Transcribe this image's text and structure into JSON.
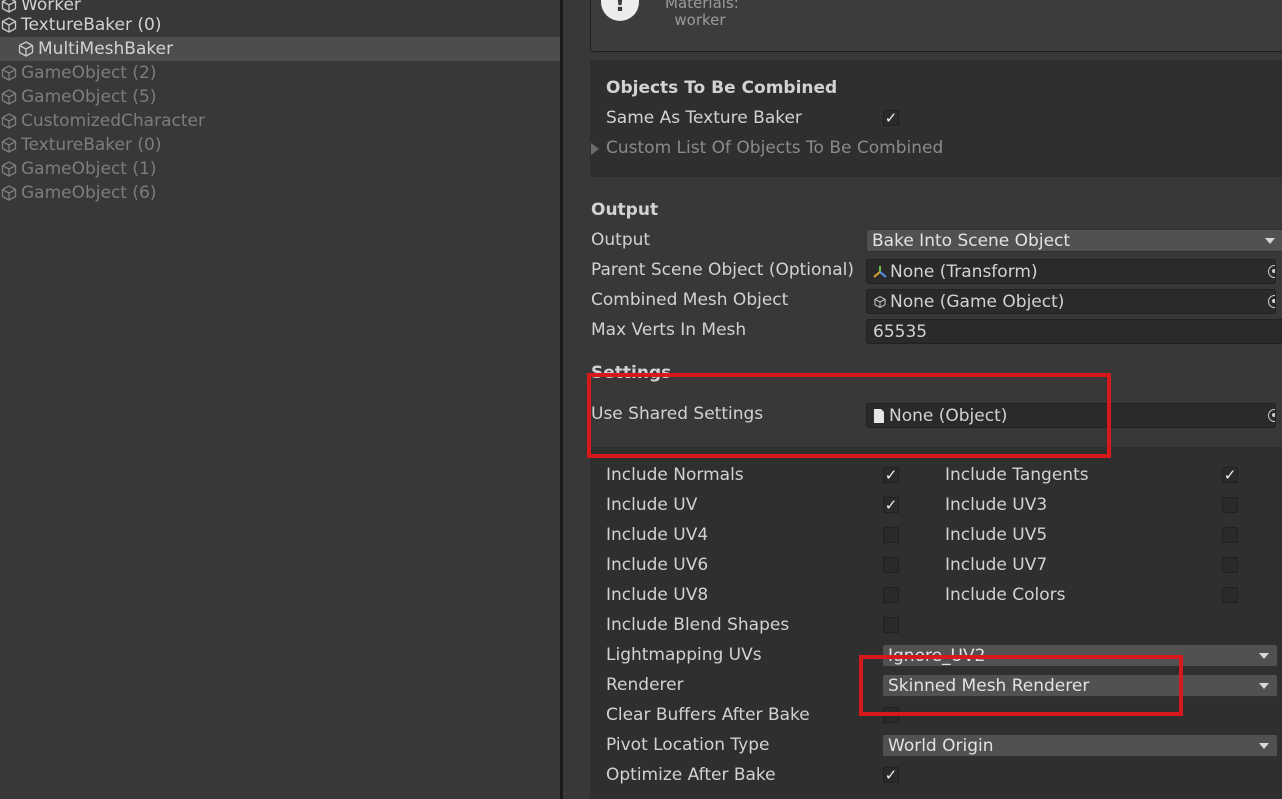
{
  "hierarchy": {
    "items": [
      {
        "label": "Worker",
        "dim": false,
        "indent": 0
      },
      {
        "label": "TextureBaker (0)",
        "dim": false,
        "indent": 0
      },
      {
        "label": "MultiMeshBaker",
        "dim": false,
        "indent": 1,
        "selected": true
      },
      {
        "label": "GameObject (2)",
        "dim": true,
        "indent": 0
      },
      {
        "label": "GameObject (5)",
        "dim": true,
        "indent": 0
      },
      {
        "label": "CustomizedCharacter",
        "dim": true,
        "indent": 0
      },
      {
        "label": "TextureBaker (0)",
        "dim": true,
        "indent": 0
      },
      {
        "label": "GameObject (1)",
        "dim": true,
        "indent": 0
      },
      {
        "label": "GameObject (6)",
        "dim": true,
        "indent": 0
      }
    ]
  },
  "warning": {
    "line1": "Materials:",
    "line2": "worker"
  },
  "objects_section": {
    "title": "Objects To Be Combined",
    "same_as_label": "Same As Texture Baker",
    "same_as_checked": true,
    "custom_list_label": "Custom List Of Objects To Be Combined"
  },
  "output_section": {
    "title": "Output",
    "output_label": "Output",
    "output_value": "Bake Into Scene Object",
    "parent_label": "Parent Scene Object (Optional)",
    "parent_value": "None (Transform)",
    "combined_label": "Combined Mesh Object",
    "combined_value": "None (Game Object)",
    "maxverts_label": "Max Verts In Mesh",
    "maxverts_value": "65535"
  },
  "settings_section": {
    "title": "Settings",
    "shared_label": "Use Shared Settings",
    "shared_value": "None (Object)"
  },
  "options": {
    "include_normals": {
      "label": "Include Normals",
      "checked": true
    },
    "include_tangents": {
      "label": "Include Tangents",
      "checked": true
    },
    "include_uv": {
      "label": "Include UV",
      "checked": true
    },
    "include_uv3": {
      "label": "Include UV3",
      "checked": false
    },
    "include_uv4": {
      "label": "Include UV4",
      "checked": false
    },
    "include_uv5": {
      "label": "Include UV5",
      "checked": false
    },
    "include_uv6": {
      "label": "Include UV6",
      "checked": false
    },
    "include_uv7": {
      "label": "Include UV7",
      "checked": false
    },
    "include_uv8": {
      "label": "Include UV8",
      "checked": false
    },
    "include_colors": {
      "label": "Include Colors",
      "checked": false
    },
    "include_blend": {
      "label": "Include Blend Shapes",
      "checked": false
    },
    "lightmapping_label": "Lightmapping UVs",
    "lightmapping_value": "Ignore_UV2",
    "renderer_label": "Renderer",
    "renderer_value": "Skinned Mesh Renderer",
    "clear_buffers": {
      "label": "Clear Buffers After Bake",
      "checked": false
    },
    "pivot_label": "Pivot Location Type",
    "pivot_value": "World Origin",
    "optimize": {
      "label": "Optimize After Bake",
      "checked": true
    }
  },
  "colors": {
    "highlight": "#d7191c",
    "background": "#383838"
  }
}
